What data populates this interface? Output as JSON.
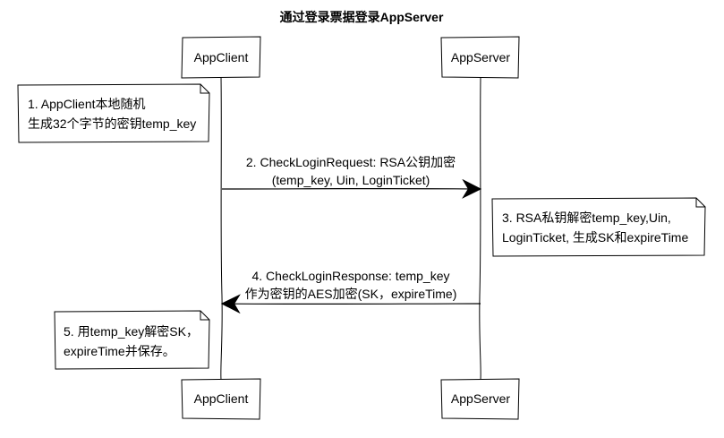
{
  "title": "通过登录票据登录AppServer",
  "participants": [
    {
      "id": "client",
      "name": "AppClient"
    },
    {
      "id": "server",
      "name": "AppServer"
    }
  ],
  "messages": [
    {
      "from": "client",
      "to": "server",
      "lines": [
        "2. CheckLoginRequest: RSA公钥加密",
        "(temp_key, Uin, LoginTicket)"
      ]
    },
    {
      "from": "server",
      "to": "client",
      "lines": [
        "4. CheckLoginResponse: temp_key",
        "作为密钥的AES加密(SK，expireTime)"
      ]
    }
  ],
  "notes": [
    {
      "lines": [
        "1. AppClient本地随机",
        "生成32个字节的密钥temp_key"
      ]
    },
    {
      "lines": [
        "3. RSA私钥解密temp_key,Uin,",
        "LoginTicket, 生成SK和expireTime"
      ]
    },
    {
      "lines": [
        "5. 用temp_key解密SK，",
        "expireTime并保存。"
      ]
    }
  ],
  "colors": {
    "stroke": "#000000",
    "fill": "#ffffff"
  }
}
